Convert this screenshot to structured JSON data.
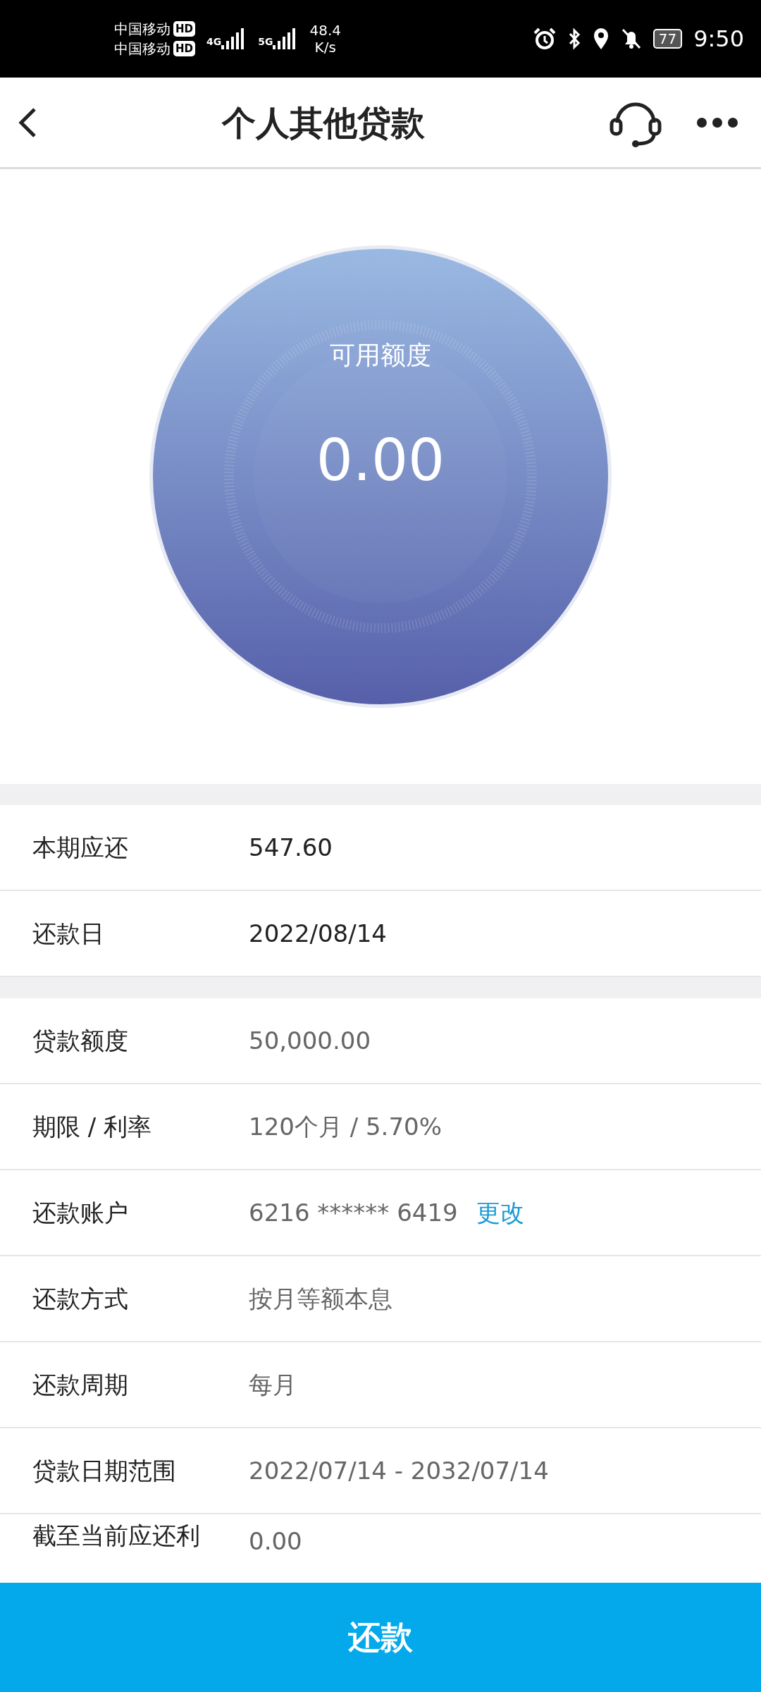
{
  "status_bar": {
    "carriers": [
      {
        "name": "中国移动",
        "badge": "HD"
      },
      {
        "name": "中国移动",
        "badge": "HD"
      }
    ],
    "networks": [
      {
        "type": "4G"
      },
      {
        "type": "5G"
      }
    ],
    "speed": "48.4",
    "speed_unit": "K/s",
    "battery": "77",
    "time": "9:50"
  },
  "header": {
    "title": "个人其他贷款"
  },
  "credit": {
    "label": "可用额度",
    "amount": "0.00"
  },
  "groups": [
    {
      "rows": [
        {
          "kind": "highlight",
          "label": "本期应还",
          "value": "547.60"
        },
        {
          "kind": "highlight",
          "label": "还款日",
          "value": "2022/08/14"
        }
      ]
    },
    {
      "rows": [
        {
          "kind": "plain",
          "label": "贷款额度",
          "value": "50,000.00"
        },
        {
          "kind": "plain",
          "label": "期限 / 利率",
          "value": "120个月 / 5.70%"
        },
        {
          "kind": "plain",
          "label": "还款账户",
          "value": "6216 ****** 6419",
          "link": "更改"
        },
        {
          "kind": "plain",
          "label": "还款方式",
          "value": "按月等额本息"
        },
        {
          "kind": "plain",
          "label": "还款周期",
          "value": "每月"
        },
        {
          "kind": "plain",
          "label": "贷款日期范围",
          "value": "2022/07/14 - 2032/07/14"
        },
        {
          "kind": "plain",
          "label": "截至当前应还利",
          "value": "0.00"
        }
      ]
    }
  ],
  "action": {
    "label": "还款"
  }
}
